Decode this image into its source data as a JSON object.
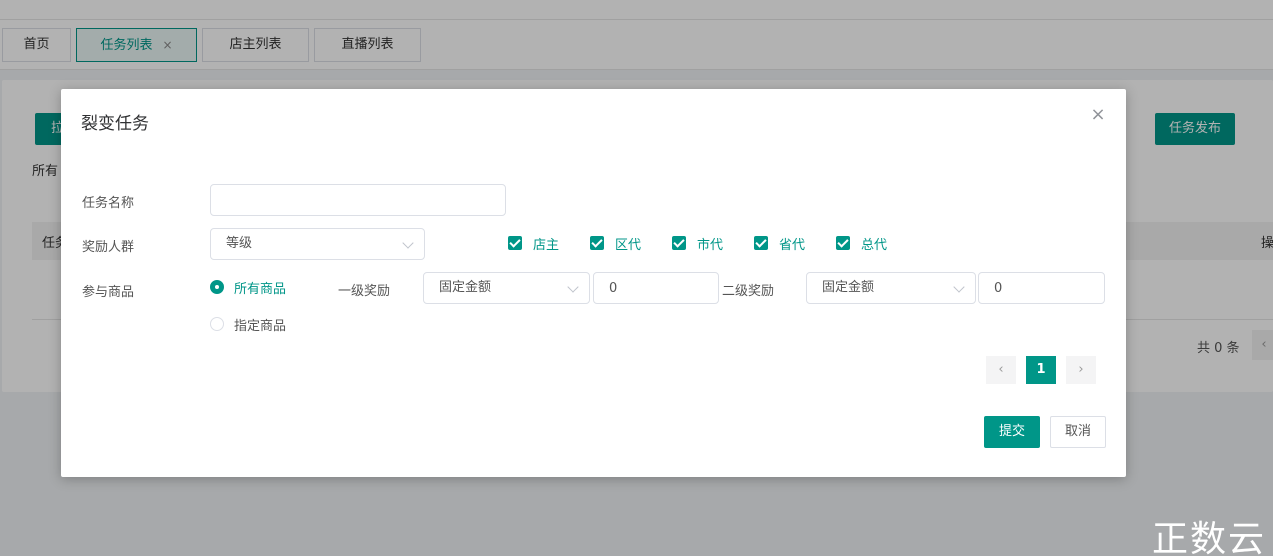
{
  "tabs": [
    {
      "label": "首页"
    },
    {
      "label": "任务列表",
      "close": "×"
    },
    {
      "label": "店主列表"
    },
    {
      "label": "直播列表"
    }
  ],
  "background": {
    "pull_button": "拉",
    "publish_button": "任务发布",
    "filter_label": "所有",
    "table_first_col": "任务",
    "table_last_col": "操",
    "total": "共 0 条",
    "prev": "‹"
  },
  "modal": {
    "title": "裂变任务",
    "close": "×",
    "task_name_label": "任务名称",
    "task_name_value": "",
    "reward_group_label": "奖励人群",
    "reward_group_select": "等级",
    "reward_roles": [
      "店主",
      "区代",
      "市代",
      "省代",
      "总代"
    ],
    "goods_label": "参与商品",
    "goods_options": [
      "所有商品",
      "指定商品"
    ],
    "level1_label": "一级奖励",
    "level1_type": "固定金额",
    "level1_value": "0",
    "level2_label": "二级奖励",
    "level2_type": "固定金额",
    "level2_value": "0",
    "pager": {
      "prev": "‹",
      "page": "1",
      "next": "›"
    },
    "submit": "提交",
    "cancel": "取消"
  },
  "watermark": "正数云",
  "colors": {
    "accent": "#009688"
  }
}
